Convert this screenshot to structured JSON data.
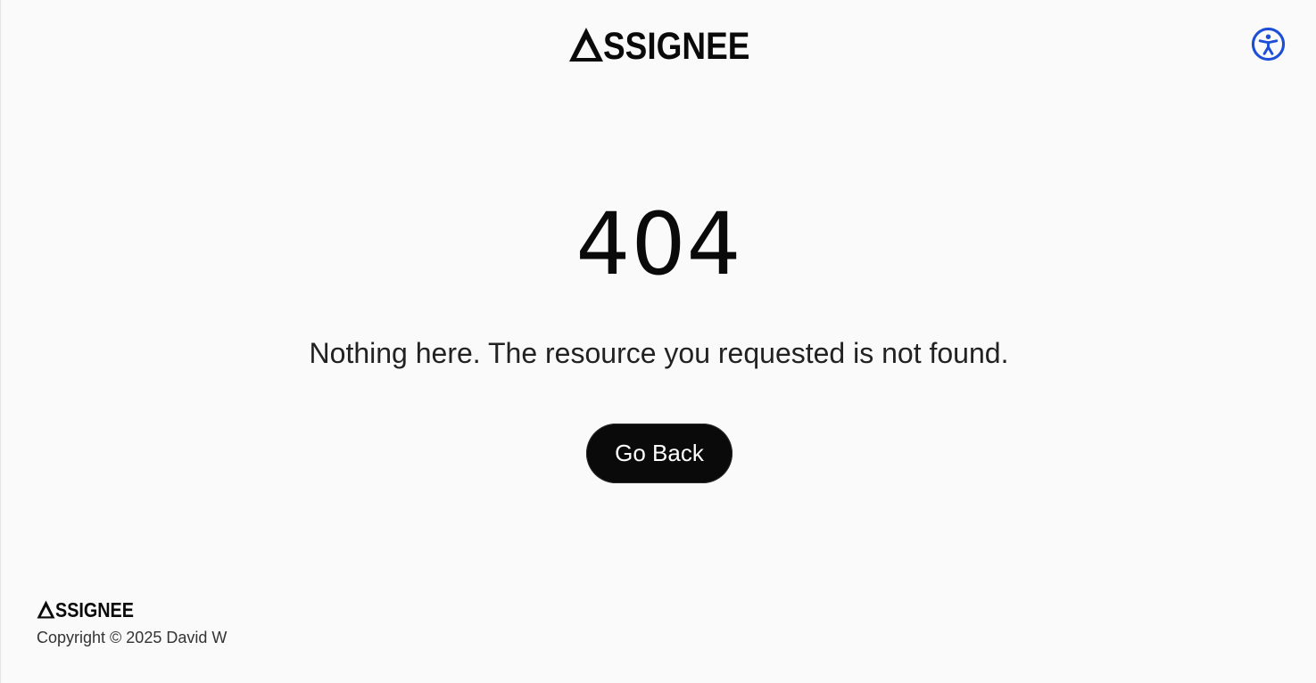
{
  "header": {
    "logo_text": "SSIGNEE",
    "accessibility_label": "Accessibility"
  },
  "main": {
    "error_code": "404",
    "message": "Nothing here. The resource you requested is not found.",
    "go_back_label": "Go Back"
  },
  "footer": {
    "logo_text": "SSIGNEE",
    "copyright": "Copyright © 2025 David W"
  },
  "icons": {
    "accessibility": "accessibility-icon",
    "logo_mark": "triangle-a-icon"
  },
  "colors": {
    "background": "#fafafa",
    "text": "#0a0a0a",
    "button_bg": "#0a0a0a",
    "button_text": "#ffffff",
    "accent": "#1d4ed8"
  }
}
